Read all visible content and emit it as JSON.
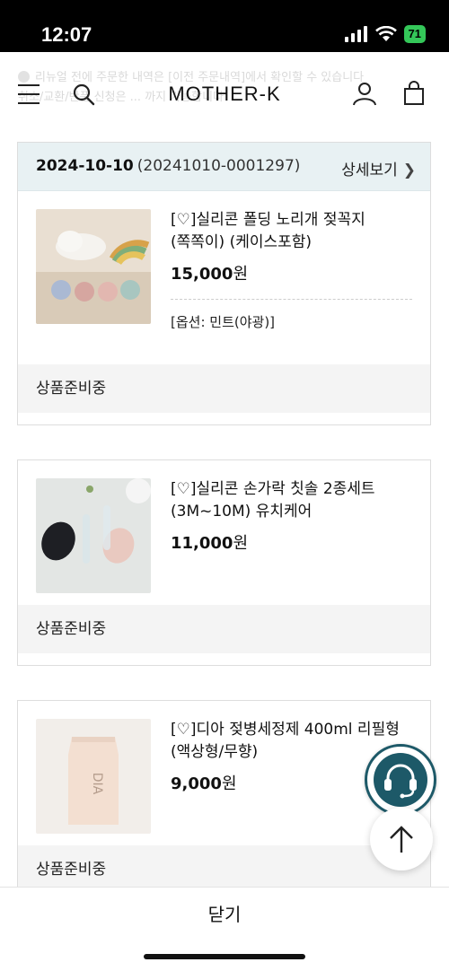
{
  "status_bar": {
    "time": "12:07",
    "battery": "71"
  },
  "notice_ghost": {
    "line1": "리뉴얼 전에 주문한 내역은 [이전 주문내역]에서 확인할 수 있습니다",
    "line2": "취소/교환/반품 신청은 ... 까지 가능합니다"
  },
  "header": {
    "logo": "MOTHER-K"
  },
  "order": {
    "date": "2024-10-10",
    "number": "(20241010-0001297)",
    "detail_label": "상세보기",
    "items": [
      {
        "name": "[♡]실리콘 폴딩 노리개 젖꼭지 (쪽쪽이) (케이스포함)",
        "price": "15,000",
        "currency": "원",
        "option": "[옵션: 민트(야광)]",
        "status": "상품준비중"
      },
      {
        "name": "[♡]실리콘 손가락 칫솔 2종세트 (3M~10M) 유치케어",
        "price": "11,000",
        "currency": "원",
        "status": "상품준비중"
      },
      {
        "name": "[♡]디아 젖병세정제 400ml 리필형 (액상형/무향)",
        "price": "9,000",
        "currency": "원",
        "status": "상품준비중"
      }
    ]
  },
  "footer": {
    "close_label": "닫기"
  },
  "colors": {
    "accent": "#1d5968",
    "card_header": "#e8f1f3",
    "status_bg": "#f4f4f4"
  },
  "icons": [
    "menu-icon",
    "search-icon",
    "user-icon",
    "bag-icon",
    "chat-support-icon",
    "arrow-up-icon"
  ]
}
